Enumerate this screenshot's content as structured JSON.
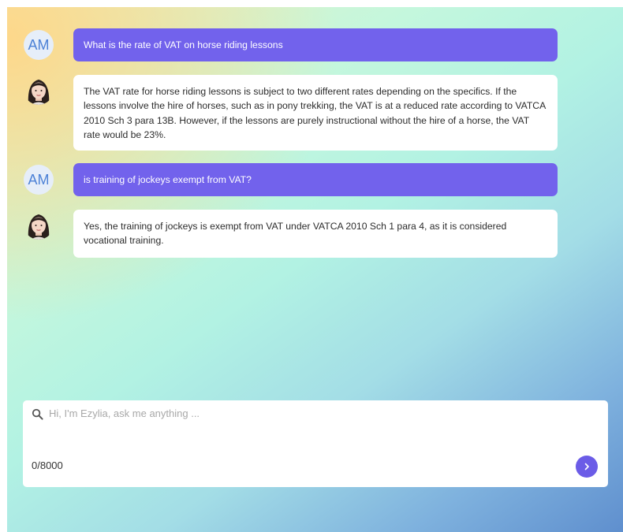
{
  "messages": [
    {
      "role": "user",
      "avatar_text": "AM",
      "text": "What is the rate of VAT on horse riding lessons"
    },
    {
      "role": "assistant",
      "avatar": "assistant-face-icon",
      "text": "The VAT rate for horse riding lessons is subject to two different rates depending on the specifics. If the lessons involve the hire of horses, such as in pony trekking, the VAT is at a reduced rate according to VATCA 2010 Sch 3 para 13B. However, if the lessons are purely instructional without the hire of a horse, the VAT rate would be 23%."
    },
    {
      "role": "user",
      "avatar_text": "AM",
      "text": "is training of jockeys exempt from VAT?"
    },
    {
      "role": "assistant",
      "avatar": "assistant-face-icon",
      "text": "Yes, the training of jockeys is exempt from VAT under VATCA 2010 Sch 1 para 4, as it is considered vocational training."
    }
  ],
  "input": {
    "placeholder": "Hi, I'm Ezylia, ask me anything ...",
    "value": "",
    "counter": "0/8000",
    "send_icon": "chevron-right-icon",
    "search_icon": "search-icon"
  },
  "colors": {
    "user_bubble": "#7262ec",
    "send_button": "#6b5ce7",
    "user_avatar_bg": "#e6eef9",
    "user_avatar_text": "#4d82d6"
  }
}
